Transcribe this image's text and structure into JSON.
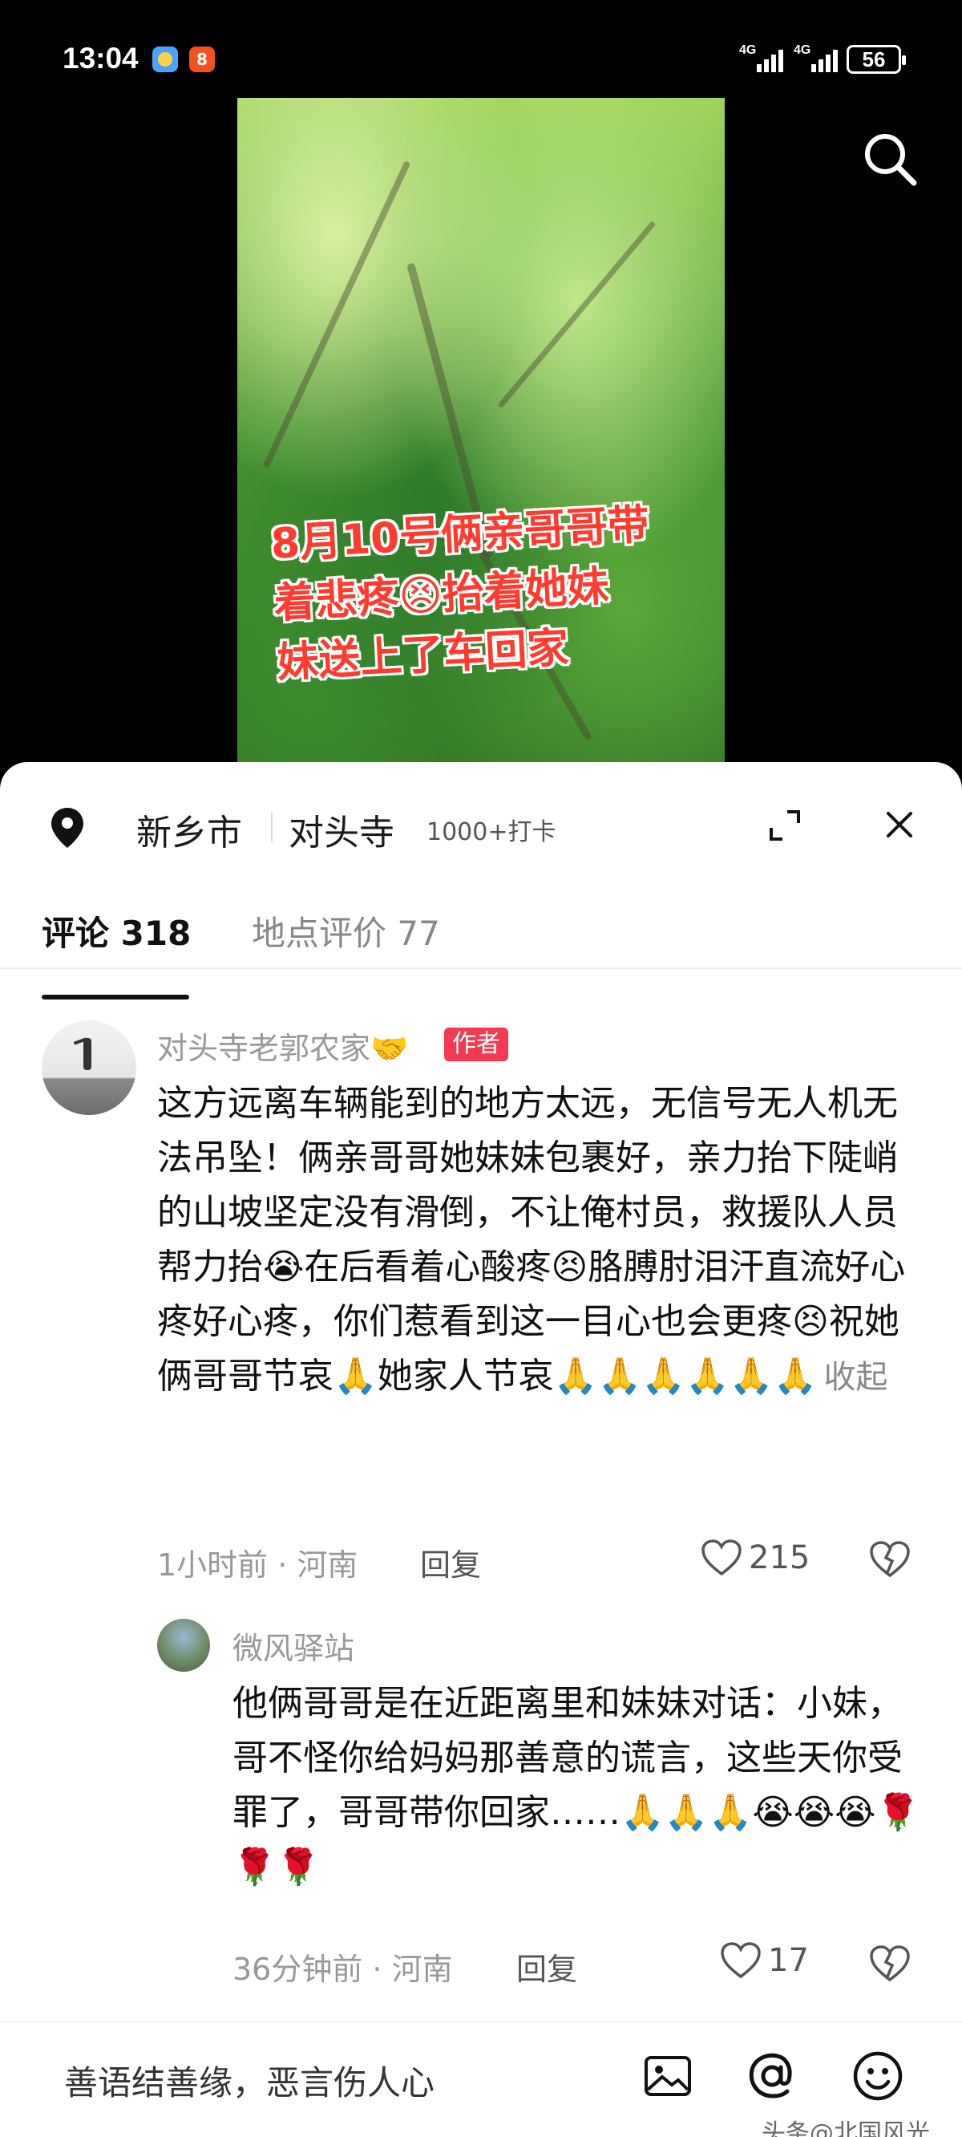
{
  "status_bar": {
    "time": "13:04",
    "app_icon_text": "8",
    "signal1_label": "4G",
    "signal2_label": "4G",
    "battery": "56"
  },
  "video": {
    "caption": "8月10号俩亲哥哥带\n着悲疼😣抬着她妹\n妹送上了车回家"
  },
  "location": {
    "city": "新乡市",
    "place": "对头寺",
    "checkins": "1000+打卡"
  },
  "tabs": [
    {
      "label": "评论 318"
    },
    {
      "label": "地点评价 77"
    }
  ],
  "comments": [
    {
      "name": "对头寺老郭农家🤝",
      "tag": "作者",
      "text": "这方远离车辆能到的地方太远，无信号无人机无法吊坠！俩亲哥哥她妹妹包裹好，亲力抬下陡峭的山坡坚定没有滑倒，不让俺村员，救援队人员帮力抬😭在后看着心酸疼😣胳膊肘泪汗直流好心疼好心疼，你们惹看到这一目心也会更疼😣祝她俩哥哥节哀🙏她家人节哀🙏🙏🙏🙏🙏🙏",
      "fold": "收起",
      "time_loc": "1小时前 · 河南",
      "reply": "回复",
      "likes": "215"
    },
    {
      "name": "微风驿站",
      "text": "他俩哥哥是在近距离里和妹妹对话：小妹，哥不怪你给妈妈那善意的谎言，这些天你受罪了，哥哥带你回家……🙏🙏🙏😭😭😭🌹🌹🌹",
      "time_loc": "36分钟前 · 河南",
      "reply": "回复",
      "likes": "17"
    }
  ],
  "input": {
    "placeholder": "善语结善缘，恶言伤人心"
  },
  "watermark": "头条@北国风光",
  "colors": {
    "author_tag": "#f23a52",
    "caption": "#ff3b2f"
  }
}
